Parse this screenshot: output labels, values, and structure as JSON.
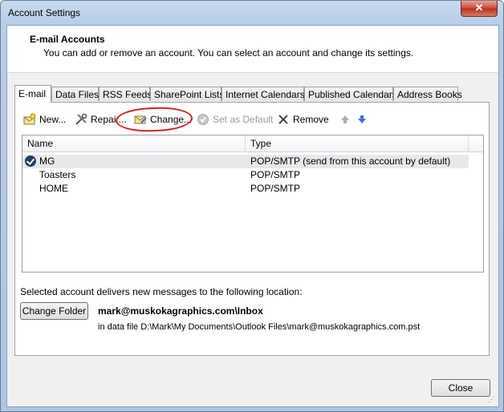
{
  "window": {
    "title": "Account Settings",
    "close_glyph": "✕"
  },
  "header": {
    "title": "E-mail Accounts",
    "subtitle": "You can add or remove an account. You can select an account and change its settings."
  },
  "tabs": [
    {
      "label": "E-mail"
    },
    {
      "label": "Data Files"
    },
    {
      "label": "RSS Feeds"
    },
    {
      "label": "SharePoint Lists"
    },
    {
      "label": "Internet Calendars"
    },
    {
      "label": "Published Calendars"
    },
    {
      "label": "Address Books"
    }
  ],
  "toolbar": {
    "new": "New...",
    "repair": "Repair...",
    "change": "Change...",
    "set_default": "Set as Default",
    "remove": "Remove"
  },
  "list": {
    "columns": [
      "Name",
      "Type"
    ],
    "rows": [
      {
        "name": "MG",
        "type": "POP/SMTP (send from this account by default)"
      },
      {
        "name": "Toasters",
        "type": "POP/SMTP"
      },
      {
        "name": "HOME",
        "type": "POP/SMTP"
      }
    ]
  },
  "delivery": {
    "label": "Selected account delivers new messages to the following location:",
    "change_folder": "Change Folder",
    "folder": "mark@muskokagraphics.com\\Inbox",
    "data_file": "in data file D:\\Mark\\My Documents\\Outlook Files\\mark@muskokagraphics.com.pst"
  },
  "footer": {
    "close": "Close"
  },
  "colors": {
    "annotation": "#d42020",
    "window_frame": "#b8cde8"
  }
}
